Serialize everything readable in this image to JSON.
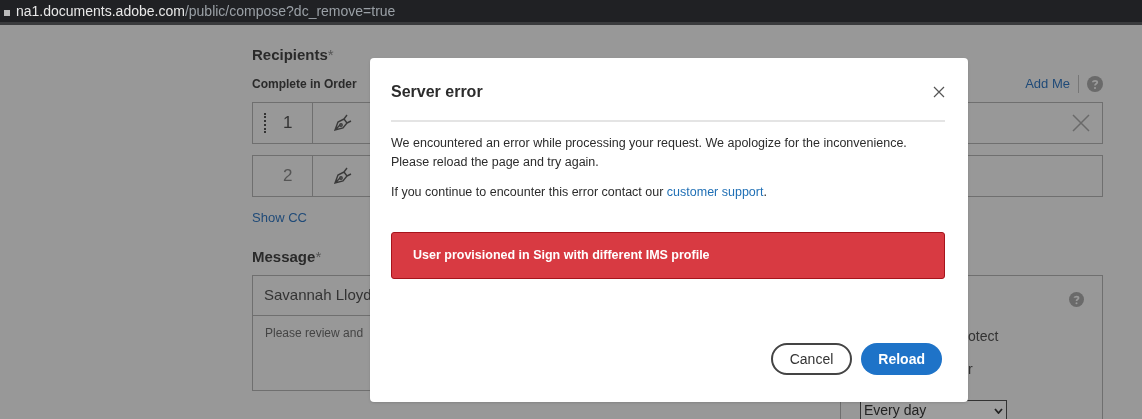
{
  "address_bar": {
    "domain": "na1.documents.adobe.com",
    "path": "/public/compose?dc_remove=true"
  },
  "page": {
    "recipients_heading": "Recipients",
    "recipients_required": "*",
    "order_label": "Complete in Order",
    "add_me": "Add Me",
    "recipients": [
      {
        "number": "1",
        "active": true
      },
      {
        "number": "2",
        "active": false
      }
    ],
    "show_cc": "Show CC",
    "message_heading": "Message",
    "message_required": "*",
    "message_subject": "Savannah Lloyd",
    "message_body": "Please review and",
    "options_fragment_1": "otect",
    "options_fragment_2": "r",
    "reminder_select": "Every day"
  },
  "dialog": {
    "title": "Server error",
    "paragraph_1": "We encountered an error while processing your request. We apologize for the inconvenience. Please reload the page and try again.",
    "paragraph_2_before": "If you continue to encounter this error contact our ",
    "paragraph_2_link": "customer support",
    "paragraph_2_after": ".",
    "error_message": "User provisioned in Sign with different IMS profile",
    "buttons": [
      {
        "label": "Cancel",
        "kind": "secondary"
      },
      {
        "label": "Reload",
        "kind": "primary"
      }
    ]
  }
}
